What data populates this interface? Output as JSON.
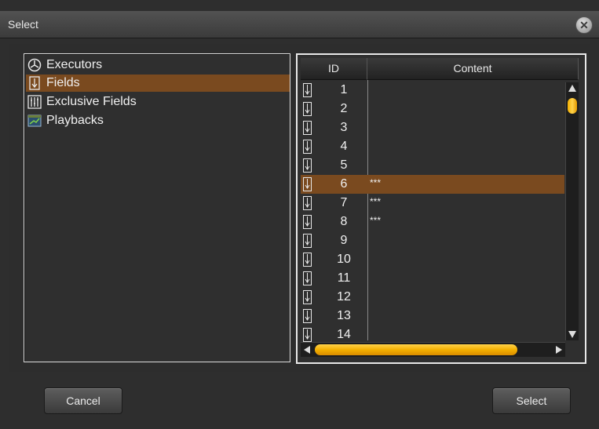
{
  "window": {
    "title": "Select",
    "close_label": "✕"
  },
  "tree": {
    "items": [
      {
        "label": "Executors",
        "icon": "executor-icon",
        "selected": false
      },
      {
        "label": "Fields",
        "icon": "field-icon",
        "selected": true
      },
      {
        "label": "Exclusive Fields",
        "icon": "exclusive-fields-icon",
        "selected": false
      },
      {
        "label": "Playbacks",
        "icon": "playback-icon",
        "selected": false
      }
    ]
  },
  "table": {
    "columns": {
      "id": "ID",
      "content": "Content"
    },
    "rows": [
      {
        "id": "1",
        "content": ""
      },
      {
        "id": "2",
        "content": ""
      },
      {
        "id": "3",
        "content": ""
      },
      {
        "id": "4",
        "content": ""
      },
      {
        "id": "5",
        "content": ""
      },
      {
        "id": "6",
        "content": "***",
        "selected": true
      },
      {
        "id": "7",
        "content": "***"
      },
      {
        "id": "8",
        "content": "***"
      },
      {
        "id": "9",
        "content": ""
      },
      {
        "id": "10",
        "content": ""
      },
      {
        "id": "11",
        "content": ""
      },
      {
        "id": "12",
        "content": ""
      },
      {
        "id": "13",
        "content": ""
      },
      {
        "id": "14",
        "content": ""
      }
    ]
  },
  "buttons": {
    "cancel": "Cancel",
    "select": "Select"
  },
  "colors": {
    "selection": "#7a4a1f",
    "scroll_thumb": "#f4b000"
  }
}
